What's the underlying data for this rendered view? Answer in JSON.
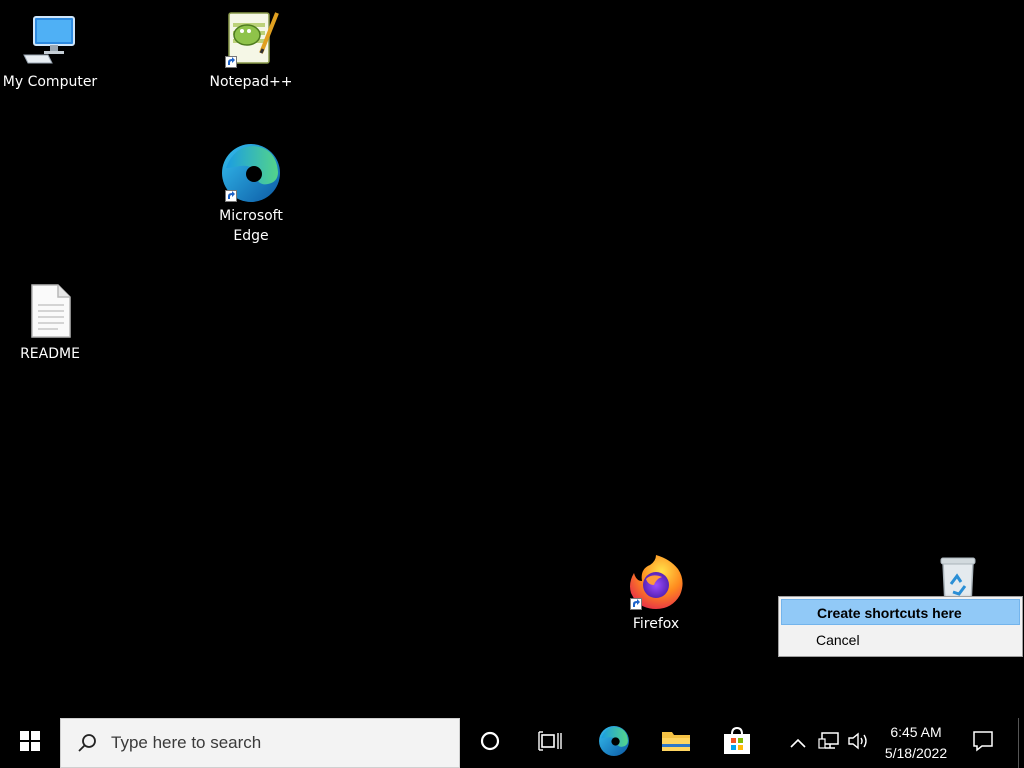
{
  "desktop": {
    "icons": [
      {
        "label": "My Computer",
        "icon": "computer-icon",
        "shortcut": false
      },
      {
        "label": "Notepad++",
        "icon": "notepad-plus-plus-icon",
        "shortcut": true
      },
      {
        "label": "Microsoft\nEdge",
        "icon": "edge-icon",
        "shortcut": true
      },
      {
        "label": "README",
        "icon": "text-file-icon",
        "shortcut": false
      },
      {
        "label": "Firefox",
        "icon": "firefox-icon",
        "shortcut": true
      },
      {
        "label": "",
        "icon": "recycle-bin-icon",
        "shortcut": false
      }
    ]
  },
  "context_menu": {
    "items": [
      {
        "label": "Create shortcuts here",
        "selected": true
      },
      {
        "label": "Cancel",
        "selected": false
      }
    ]
  },
  "taskbar": {
    "start_icon": "windows-logo-icon",
    "search": {
      "placeholder": "Type here to search",
      "icon": "search-icon"
    },
    "cortana_icon": "cortana-circle-icon",
    "task_view_icon": "task-view-icon",
    "pinned": [
      {
        "name": "Microsoft Edge",
        "icon": "edge-icon"
      },
      {
        "name": "File Explorer",
        "icon": "folder-icon"
      },
      {
        "name": "Microsoft Store",
        "icon": "store-icon"
      }
    ],
    "tray": {
      "chevron_icon": "chevron-up-icon",
      "network_icon": "network-icon",
      "volume_icon": "volume-icon",
      "time": "6:45 AM",
      "date": "5/18/2022",
      "notification_icon": "notification-icon"
    }
  },
  "colors": {
    "desktop_bg": "#000000",
    "menu_bg": "#f2f2f2",
    "menu_highlight": "#91c9f7",
    "search_bg": "#f3f3f3"
  }
}
